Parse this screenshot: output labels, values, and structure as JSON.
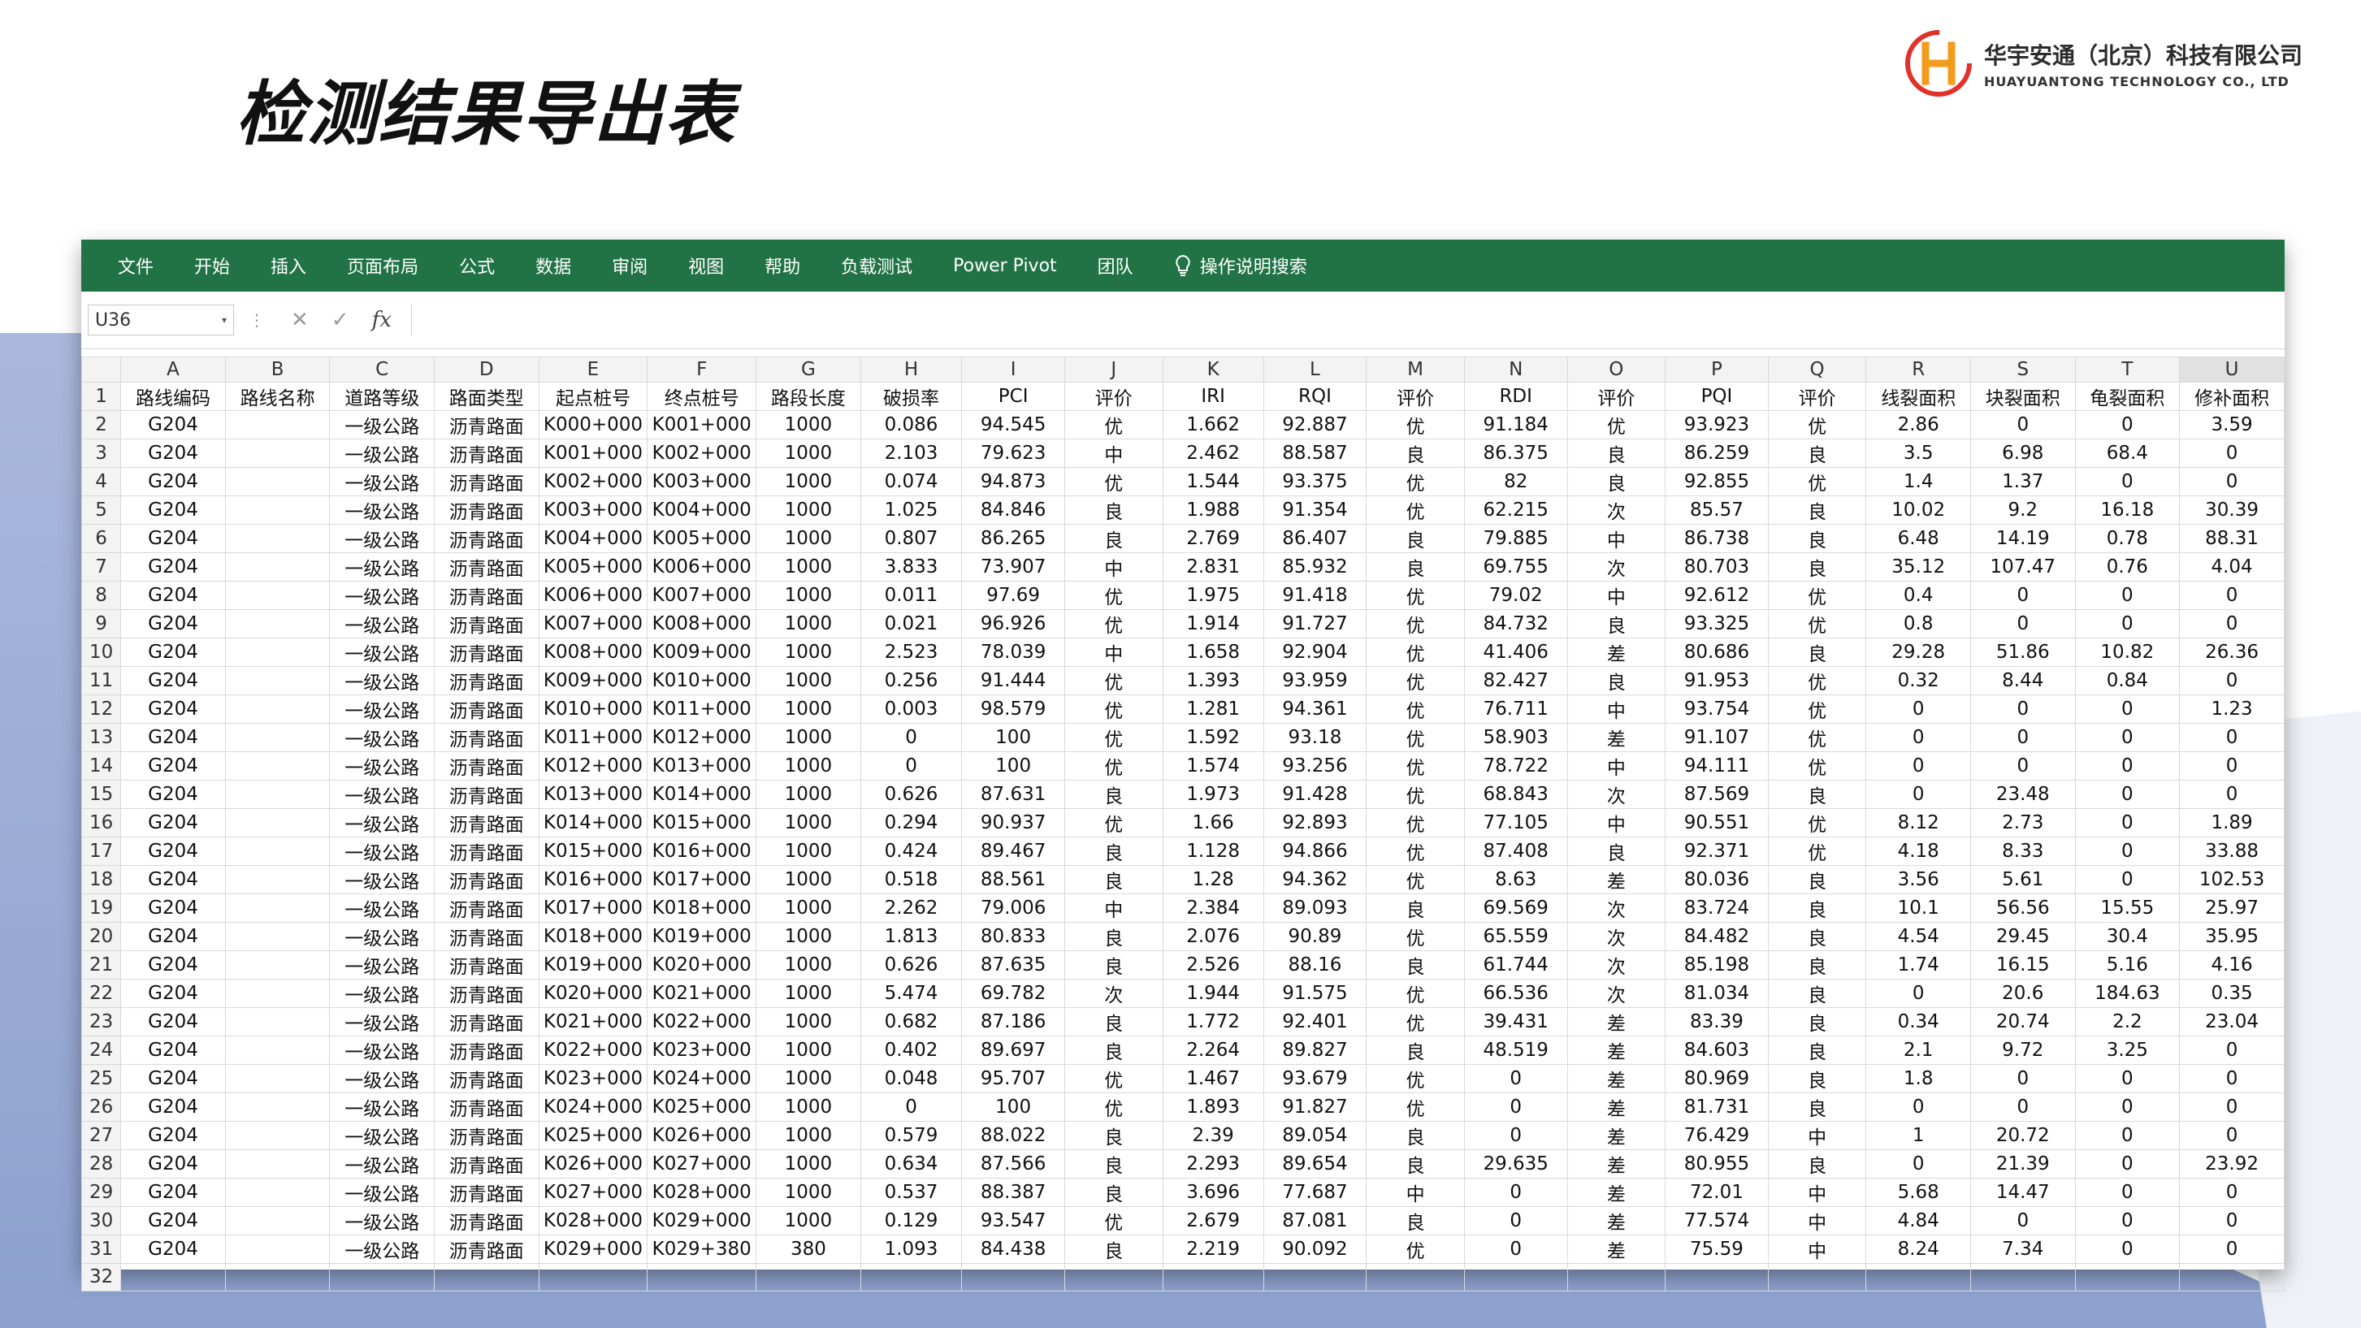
{
  "page_title": "检测结果导出表",
  "logo": {
    "mark": "H",
    "cn": "华宇安通（北京）科技有限公司",
    "en": "HUAYUANTONG TECHNOLOGY CO., LTD"
  },
  "colors": {
    "ribbon": "#217346",
    "accent_red": "#e0312a",
    "accent_orange": "#f29b1c"
  },
  "ribbon_tabs": [
    "文件",
    "开始",
    "插入",
    "页面布局",
    "公式",
    "数据",
    "审阅",
    "视图",
    "帮助",
    "负载测试",
    "Power Pivot",
    "团队"
  ],
  "tell_me": "操作说明搜索",
  "name_box": "U36",
  "fx_label": "fx",
  "column_letters": [
    "A",
    "B",
    "C",
    "D",
    "E",
    "F",
    "G",
    "H",
    "I",
    "J",
    "K",
    "L",
    "M",
    "N",
    "O",
    "P",
    "Q",
    "R",
    "S",
    "T",
    "U"
  ],
  "headers": [
    "路线编码",
    "路线名称",
    "道路等级",
    "路面类型",
    "起点桩号",
    "终点桩号",
    "路段长度",
    "破损率",
    "PCI",
    "评价",
    "IRI",
    "RQI",
    "评价",
    "RDI",
    "评价",
    "PQI",
    "评价",
    "线裂面积",
    "块裂面积",
    "龟裂面积",
    "修补面积"
  ],
  "rows": [
    [
      "G204",
      "",
      "一级公路",
      "沥青路面",
      "K000+000",
      "K001+000",
      "1000",
      "0.086",
      "94.545",
      "优",
      "1.662",
      "92.887",
      "优",
      "91.184",
      "优",
      "93.923",
      "优",
      "2.86",
      "0",
      "0",
      "3.59"
    ],
    [
      "G204",
      "",
      "一级公路",
      "沥青路面",
      "K001+000",
      "K002+000",
      "1000",
      "2.103",
      "79.623",
      "中",
      "2.462",
      "88.587",
      "良",
      "86.375",
      "良",
      "86.259",
      "良",
      "3.5",
      "6.98",
      "68.4",
      "0"
    ],
    [
      "G204",
      "",
      "一级公路",
      "沥青路面",
      "K002+000",
      "K003+000",
      "1000",
      "0.074",
      "94.873",
      "优",
      "1.544",
      "93.375",
      "优",
      "82",
      "良",
      "92.855",
      "优",
      "1.4",
      "1.37",
      "0",
      "0"
    ],
    [
      "G204",
      "",
      "一级公路",
      "沥青路面",
      "K003+000",
      "K004+000",
      "1000",
      "1.025",
      "84.846",
      "良",
      "1.988",
      "91.354",
      "优",
      "62.215",
      "次",
      "85.57",
      "良",
      "10.02",
      "9.2",
      "16.18",
      "30.39"
    ],
    [
      "G204",
      "",
      "一级公路",
      "沥青路面",
      "K004+000",
      "K005+000",
      "1000",
      "0.807",
      "86.265",
      "良",
      "2.769",
      "86.407",
      "良",
      "79.885",
      "中",
      "86.738",
      "良",
      "6.48",
      "14.19",
      "0.78",
      "88.31"
    ],
    [
      "G204",
      "",
      "一级公路",
      "沥青路面",
      "K005+000",
      "K006+000",
      "1000",
      "3.833",
      "73.907",
      "中",
      "2.831",
      "85.932",
      "良",
      "69.755",
      "次",
      "80.703",
      "良",
      "35.12",
      "107.47",
      "0.76",
      "4.04"
    ],
    [
      "G204",
      "",
      "一级公路",
      "沥青路面",
      "K006+000",
      "K007+000",
      "1000",
      "0.011",
      "97.69",
      "优",
      "1.975",
      "91.418",
      "优",
      "79.02",
      "中",
      "92.612",
      "优",
      "0.4",
      "0",
      "0",
      "0"
    ],
    [
      "G204",
      "",
      "一级公路",
      "沥青路面",
      "K007+000",
      "K008+000",
      "1000",
      "0.021",
      "96.926",
      "优",
      "1.914",
      "91.727",
      "优",
      "84.732",
      "良",
      "93.325",
      "优",
      "0.8",
      "0",
      "0",
      "0"
    ],
    [
      "G204",
      "",
      "一级公路",
      "沥青路面",
      "K008+000",
      "K009+000",
      "1000",
      "2.523",
      "78.039",
      "中",
      "1.658",
      "92.904",
      "优",
      "41.406",
      "差",
      "80.686",
      "良",
      "29.28",
      "51.86",
      "10.82",
      "26.36"
    ],
    [
      "G204",
      "",
      "一级公路",
      "沥青路面",
      "K009+000",
      "K010+000",
      "1000",
      "0.256",
      "91.444",
      "优",
      "1.393",
      "93.959",
      "优",
      "82.427",
      "良",
      "91.953",
      "优",
      "0.32",
      "8.44",
      "0.84",
      "0"
    ],
    [
      "G204",
      "",
      "一级公路",
      "沥青路面",
      "K010+000",
      "K011+000",
      "1000",
      "0.003",
      "98.579",
      "优",
      "1.281",
      "94.361",
      "优",
      "76.711",
      "中",
      "93.754",
      "优",
      "0",
      "0",
      "0",
      "1.23"
    ],
    [
      "G204",
      "",
      "一级公路",
      "沥青路面",
      "K011+000",
      "K012+000",
      "1000",
      "0",
      "100",
      "优",
      "1.592",
      "93.18",
      "优",
      "58.903",
      "差",
      "91.107",
      "优",
      "0",
      "0",
      "0",
      "0"
    ],
    [
      "G204",
      "",
      "一级公路",
      "沥青路面",
      "K012+000",
      "K013+000",
      "1000",
      "0",
      "100",
      "优",
      "1.574",
      "93.256",
      "优",
      "78.722",
      "中",
      "94.111",
      "优",
      "0",
      "0",
      "0",
      "0"
    ],
    [
      "G204",
      "",
      "一级公路",
      "沥青路面",
      "K013+000",
      "K014+000",
      "1000",
      "0.626",
      "87.631",
      "良",
      "1.973",
      "91.428",
      "优",
      "68.843",
      "次",
      "87.569",
      "良",
      "0",
      "23.48",
      "0",
      "0"
    ],
    [
      "G204",
      "",
      "一级公路",
      "沥青路面",
      "K014+000",
      "K015+000",
      "1000",
      "0.294",
      "90.937",
      "优",
      "1.66",
      "92.893",
      "优",
      "77.105",
      "中",
      "90.551",
      "优",
      "8.12",
      "2.73",
      "0",
      "1.89"
    ],
    [
      "G204",
      "",
      "一级公路",
      "沥青路面",
      "K015+000",
      "K016+000",
      "1000",
      "0.424",
      "89.467",
      "良",
      "1.128",
      "94.866",
      "优",
      "87.408",
      "良",
      "92.371",
      "优",
      "4.18",
      "8.33",
      "0",
      "33.88"
    ],
    [
      "G204",
      "",
      "一级公路",
      "沥青路面",
      "K016+000",
      "K017+000",
      "1000",
      "0.518",
      "88.561",
      "良",
      "1.28",
      "94.362",
      "优",
      "8.63",
      "差",
      "80.036",
      "良",
      "3.56",
      "5.61",
      "0",
      "102.53"
    ],
    [
      "G204",
      "",
      "一级公路",
      "沥青路面",
      "K017+000",
      "K018+000",
      "1000",
      "2.262",
      "79.006",
      "中",
      "2.384",
      "89.093",
      "良",
      "69.569",
      "次",
      "83.724",
      "良",
      "10.1",
      "56.56",
      "15.55",
      "25.97"
    ],
    [
      "G204",
      "",
      "一级公路",
      "沥青路面",
      "K018+000",
      "K019+000",
      "1000",
      "1.813",
      "80.833",
      "良",
      "2.076",
      "90.89",
      "优",
      "65.559",
      "次",
      "84.482",
      "良",
      "4.54",
      "29.45",
      "30.4",
      "35.95"
    ],
    [
      "G204",
      "",
      "一级公路",
      "沥青路面",
      "K019+000",
      "K020+000",
      "1000",
      "0.626",
      "87.635",
      "良",
      "2.526",
      "88.16",
      "良",
      "61.744",
      "次",
      "85.198",
      "良",
      "1.74",
      "16.15",
      "5.16",
      "4.16"
    ],
    [
      "G204",
      "",
      "一级公路",
      "沥青路面",
      "K020+000",
      "K021+000",
      "1000",
      "5.474",
      "69.782",
      "次",
      "1.944",
      "91.575",
      "优",
      "66.536",
      "次",
      "81.034",
      "良",
      "0",
      "20.6",
      "184.63",
      "0.35"
    ],
    [
      "G204",
      "",
      "一级公路",
      "沥青路面",
      "K021+000",
      "K022+000",
      "1000",
      "0.682",
      "87.186",
      "良",
      "1.772",
      "92.401",
      "优",
      "39.431",
      "差",
      "83.39",
      "良",
      "0.34",
      "20.74",
      "2.2",
      "23.04"
    ],
    [
      "G204",
      "",
      "一级公路",
      "沥青路面",
      "K022+000",
      "K023+000",
      "1000",
      "0.402",
      "89.697",
      "良",
      "2.264",
      "89.827",
      "良",
      "48.519",
      "差",
      "84.603",
      "良",
      "2.1",
      "9.72",
      "3.25",
      "0"
    ],
    [
      "G204",
      "",
      "一级公路",
      "沥青路面",
      "K023+000",
      "K024+000",
      "1000",
      "0.048",
      "95.707",
      "优",
      "1.467",
      "93.679",
      "优",
      "0",
      "差",
      "80.969",
      "良",
      "1.8",
      "0",
      "0",
      "0"
    ],
    [
      "G204",
      "",
      "一级公路",
      "沥青路面",
      "K024+000",
      "K025+000",
      "1000",
      "0",
      "100",
      "优",
      "1.893",
      "91.827",
      "优",
      "0",
      "差",
      "81.731",
      "良",
      "0",
      "0",
      "0",
      "0"
    ],
    [
      "G204",
      "",
      "一级公路",
      "沥青路面",
      "K025+000",
      "K026+000",
      "1000",
      "0.579",
      "88.022",
      "良",
      "2.39",
      "89.054",
      "良",
      "0",
      "差",
      "76.429",
      "中",
      "1",
      "20.72",
      "0",
      "0"
    ],
    [
      "G204",
      "",
      "一级公路",
      "沥青路面",
      "K026+000",
      "K027+000",
      "1000",
      "0.634",
      "87.566",
      "良",
      "2.293",
      "89.654",
      "良",
      "29.635",
      "差",
      "80.955",
      "良",
      "0",
      "21.39",
      "0",
      "23.92"
    ],
    [
      "G204",
      "",
      "一级公路",
      "沥青路面",
      "K027+000",
      "K028+000",
      "1000",
      "0.537",
      "88.387",
      "良",
      "3.696",
      "77.687",
      "中",
      "0",
      "差",
      "72.01",
      "中",
      "5.68",
      "14.47",
      "0",
      "0"
    ],
    [
      "G204",
      "",
      "一级公路",
      "沥青路面",
      "K028+000",
      "K029+000",
      "1000",
      "0.129",
      "93.547",
      "优",
      "2.679",
      "87.081",
      "良",
      "0",
      "差",
      "77.574",
      "中",
      "4.84",
      "0",
      "0",
      "0"
    ],
    [
      "G204",
      "",
      "一级公路",
      "沥青路面",
      "K029+000",
      "K029+380",
      "380",
      "1.093",
      "84.438",
      "良",
      "2.219",
      "90.092",
      "优",
      "0",
      "差",
      "75.59",
      "中",
      "8.24",
      "7.34",
      "0",
      "0"
    ]
  ]
}
